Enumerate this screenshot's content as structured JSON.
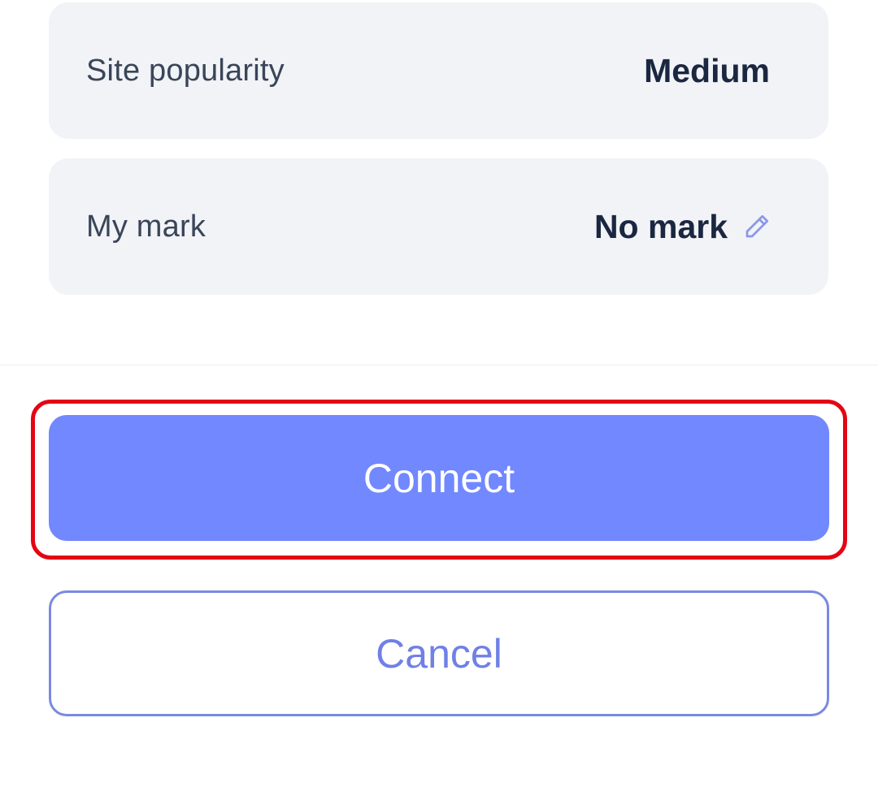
{
  "details": {
    "site_popularity": {
      "label": "Site popularity",
      "value": "Medium"
    },
    "my_mark": {
      "label": "My mark",
      "value": "No mark",
      "edit_icon": "pencil-icon"
    }
  },
  "actions": {
    "connect_label": "Connect",
    "cancel_label": "Cancel"
  },
  "colors": {
    "card_background": "#f1f3f7",
    "primary": "#7188ff",
    "cancel_border": "#7a8ae0",
    "highlight": "#e30613"
  }
}
